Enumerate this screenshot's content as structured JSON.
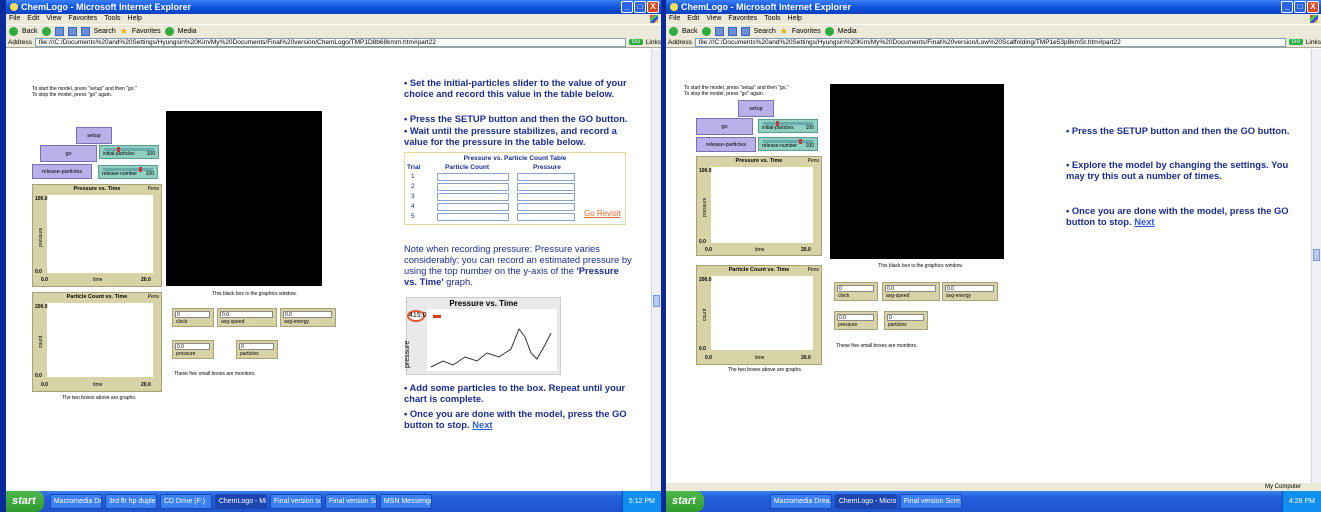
{
  "window": {
    "title": "ChemLogo - Microsoft Internet Explorer",
    "buttons": [
      "_",
      "□",
      "X"
    ]
  },
  "menu": [
    "File",
    "Edit",
    "View",
    "Favorites",
    "Tools",
    "Help"
  ],
  "toolbar": {
    "back": "Back",
    "search": "Search",
    "favorites": "Favorites",
    "media": "Media"
  },
  "address": {
    "label": "Address",
    "go": "Go",
    "links": "Links",
    "left_url": "file:///C:/Documents%20and%20Settings/Hyungsin%20Kim/My%20Documents/Final%20version/ChemLogo/TMP1D8b68kmm.htm#part22",
    "right_url": "file:///C:/Documents%20and%20Settings/Hyungsin%20Kim/My%20Documents/Final%20version/Low%20Scaffolding/TMP1e53p8kmSr.htm#part22"
  },
  "model": {
    "intro": [
      "To start the model, press \"setup\" and then \"go.\"",
      "To stop the model, press \"go\" again."
    ],
    "setup": "setup",
    "go": "go",
    "release": "release-particles",
    "slider_initial": {
      "label": "initial-particles",
      "value": "100"
    },
    "slider_release": {
      "label": "release-number",
      "value": "100"
    },
    "plot1": {
      "title": "Pressure vs. Time",
      "pen": "Pens",
      "ylabel": "pressure",
      "xlabel": "time",
      "ymax": "100.0",
      "ymin": "0.0",
      "xmin": "0.0",
      "xmax": "20.0"
    },
    "plot2": {
      "title": "Particle Count vs. Time",
      "pen": "Pens",
      "ylabel": "count",
      "xlabel": "time",
      "ymax": "200.0",
      "ymin": "0.0",
      "xmin": "0.0",
      "xmax": "20.0"
    },
    "graphics_note": "This black box is the graphics window.",
    "graphs_note": "The two boxes above are graphs.",
    "monitors_note": "These five small boxes are monitors.",
    "monitors": [
      {
        "value": "0",
        "label": "clock"
      },
      {
        "value": "0.0",
        "label": "avg-speed"
      },
      {
        "value": "0.0",
        "label": "avg-energy"
      },
      {
        "value": "0.0",
        "label": "pressure"
      },
      {
        "value": "0",
        "label": "particles"
      }
    ]
  },
  "left_instructions": {
    "p1": "• Set the initial-particles slider to the value of your choice and record this value in the table below.",
    "p2a": "• Press the SETUP button and then the GO button.",
    "p2b": "• Wait until the pressure stabilizes, and record a value for the pressure in the table below.",
    "table_title": "Pressure vs. Particle Count Table",
    "col_trial": "Trial",
    "col_count": "Particle Count",
    "col_pressure": "Pressure",
    "rows": [
      "1",
      "2",
      "3",
      "4",
      "5"
    ],
    "revisit": "Go Revisit",
    "note_a": "Note when recording pressure: Pressure varies considerably; you can record an estimated pressure by using the top number on the y-axis of the ",
    "note_b": "'Pressure vs. Time'",
    "note_c": " graph.",
    "mini_title": "Pressure vs. Time",
    "mini_value": "415.0",
    "mini_ylabel": "pressure",
    "p3": "• Add some particles to the box. Repeat until your chart is complete.",
    "p4": "• Once you are done with the model, press the GO button to stop.",
    "next": "Next"
  },
  "right_instructions": {
    "p1": "• Press the SETUP button and then the GO button.",
    "p2": "• Explore the model by changing the settings. You may try this out a number of times.",
    "p3": "• Once you are done with the model, press the GO button to stop.",
    "next": "Next"
  },
  "statusbar": {
    "right": "My Computer"
  },
  "taskbar_left": {
    "start": "start",
    "tasks": [
      "Macromedia Drea...",
      "3rd flr hp duplex",
      "CD Drive (F:)",
      "ChemLogo - Mic...",
      "Final version scr...",
      "Final version Scr...",
      "MSN Messenger"
    ],
    "clock": "5:12 PM"
  },
  "taskbar_right": {
    "start": "start",
    "tasks": [
      "Macromedia Drea...",
      "ChemLogo - Micro...",
      "Final version Scre..."
    ],
    "clock": "4:28 PM"
  }
}
